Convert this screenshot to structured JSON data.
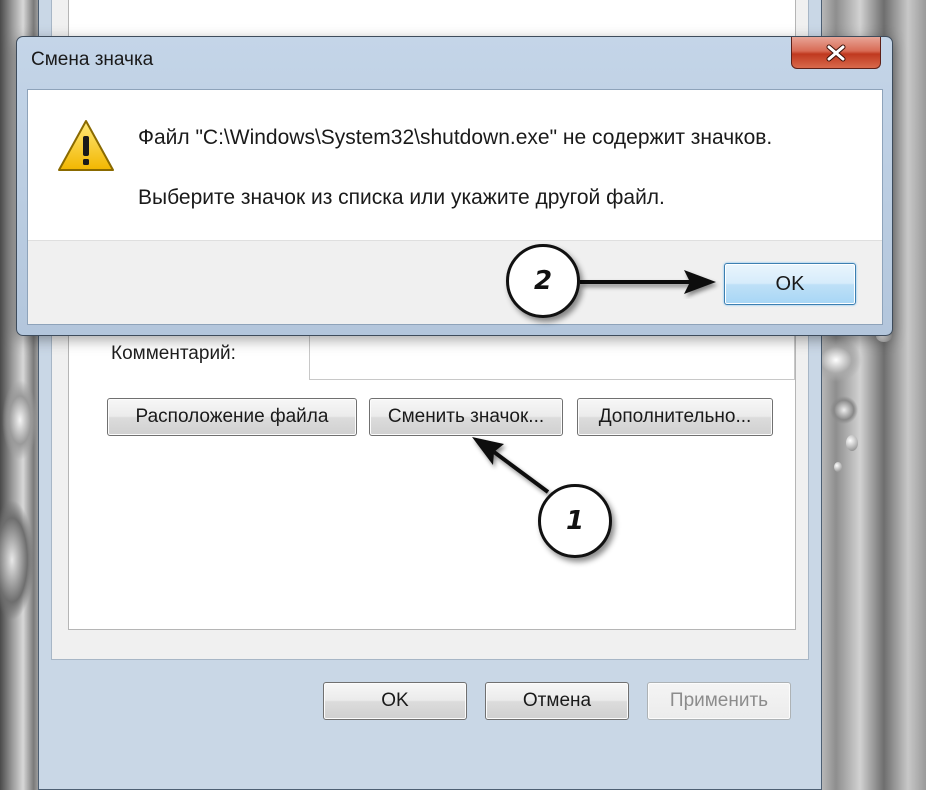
{
  "dialog": {
    "title": "Смена значка",
    "message_line1": "Файл \"C:\\Windows\\System32\\shutdown.exe\" не содержит значков.",
    "message_line2": "Выберите значок из списка или укажите другой файл.",
    "ok_label": "OK",
    "icons": {
      "warning": "warning-triangle-icon",
      "close": "close-x-icon"
    }
  },
  "properties": {
    "comment_label": "Комментарий:",
    "buttons": {
      "open_location": "Расположение файла",
      "change_icon": "Сменить значок...",
      "advanced": "Дополнительно..."
    },
    "footer": {
      "ok": "OK",
      "cancel": "Отмена",
      "apply": "Применить"
    }
  },
  "callouts": [
    {
      "number": "1",
      "target": "change-icon-button"
    },
    {
      "number": "2",
      "target": "dialog-ok-button"
    }
  ],
  "colors": {
    "close_button": "#c0391f",
    "ok_highlight": "#bee0f7",
    "warning": "#f2c200"
  }
}
